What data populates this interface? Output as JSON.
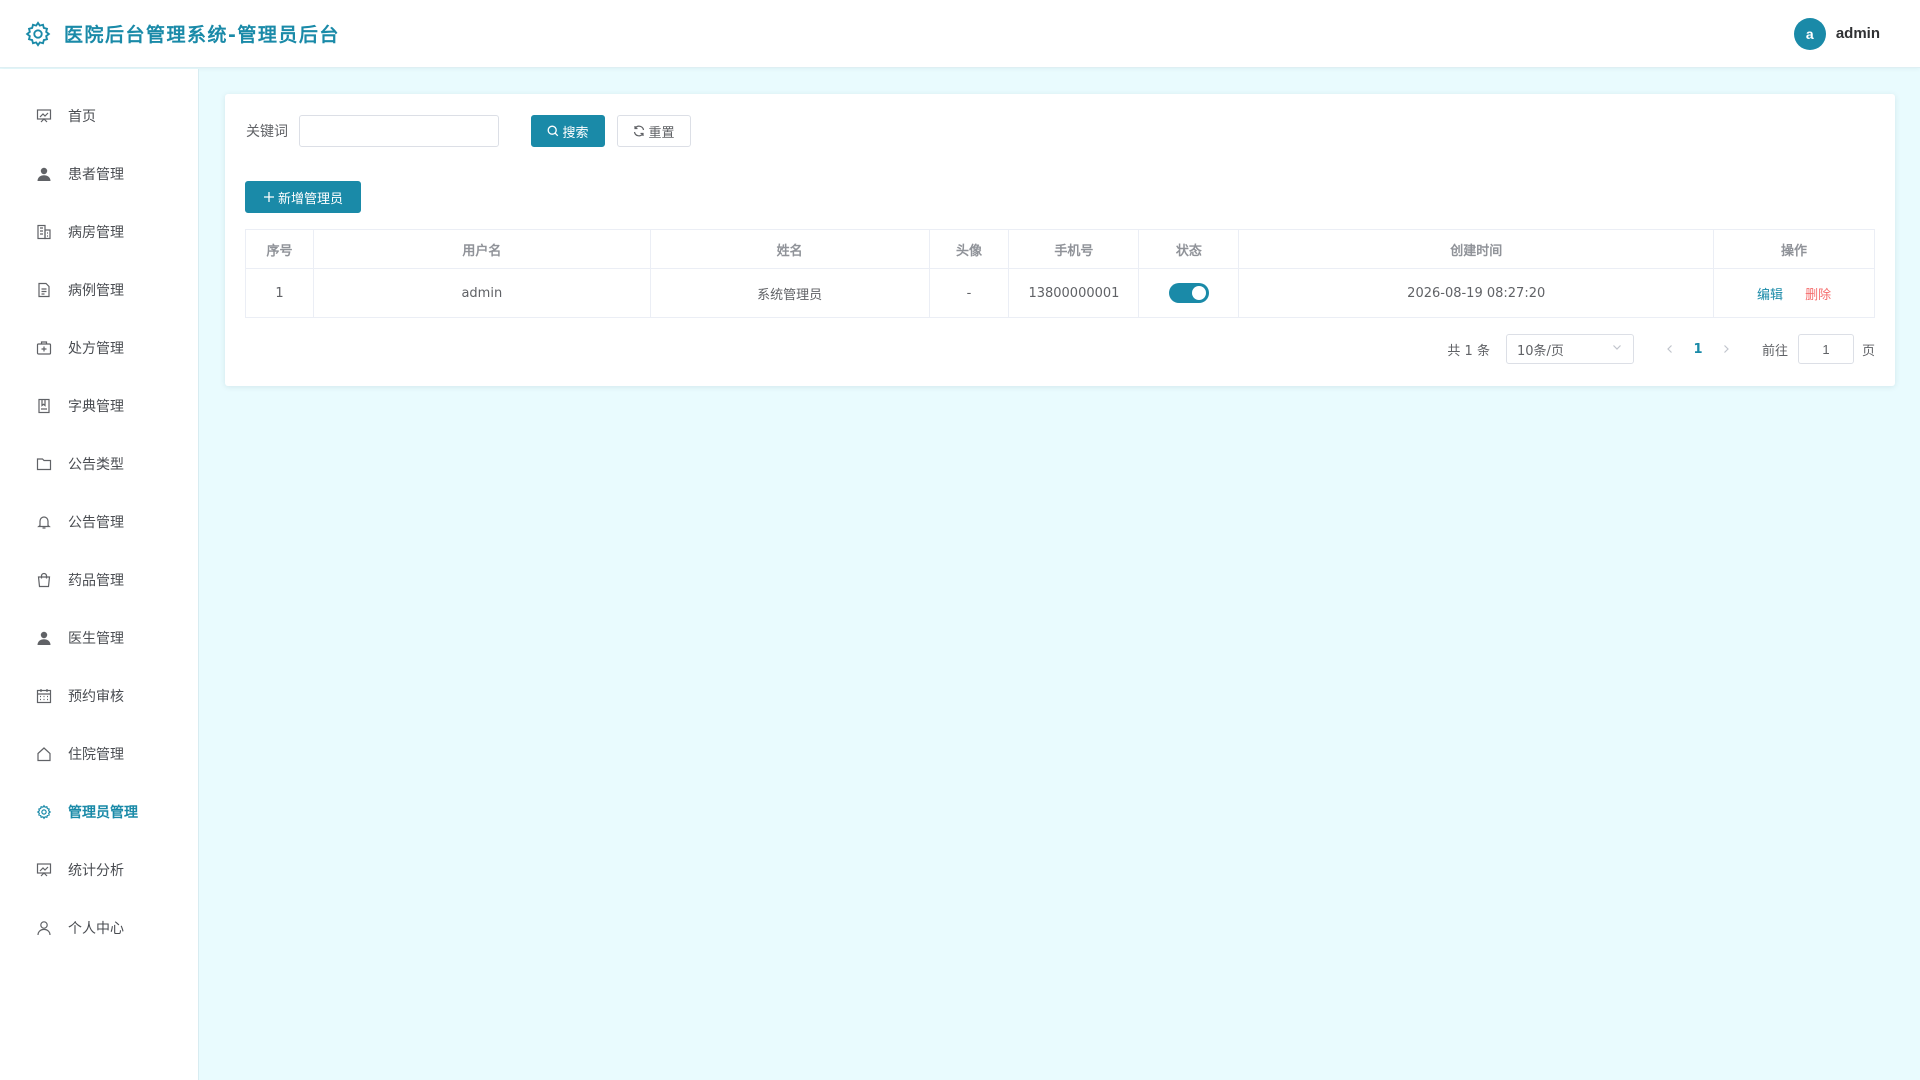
{
  "header": {
    "title": "医院后台管理系统-管理员后台",
    "avatar_letter": "a",
    "username": "admin"
  },
  "sidebar": {
    "items": [
      {
        "label": "首页",
        "icon": "chart-board-icon"
      },
      {
        "label": "患者管理",
        "icon": "user-filled-icon"
      },
      {
        "label": "病房管理",
        "icon": "building-icon"
      },
      {
        "label": "病例管理",
        "icon": "document-icon"
      },
      {
        "label": "处方管理",
        "icon": "first-aid-kit-icon"
      },
      {
        "label": "字典管理",
        "icon": "notebook-icon"
      },
      {
        "label": "公告类型",
        "icon": "folder-icon"
      },
      {
        "label": "公告管理",
        "icon": "bell-icon"
      },
      {
        "label": "药品管理",
        "icon": "shopping-bag-icon"
      },
      {
        "label": "医生管理",
        "icon": "user-filled-icon"
      },
      {
        "label": "预约审核",
        "icon": "calendar-icon"
      },
      {
        "label": "住院管理",
        "icon": "house-icon"
      },
      {
        "label": "管理员管理",
        "icon": "gear-icon",
        "active": true
      },
      {
        "label": "统计分析",
        "icon": "chart-board-icon"
      },
      {
        "label": "个人中心",
        "icon": "user-outline-icon"
      }
    ]
  },
  "search": {
    "keyword_label": "关键词",
    "keyword_value": "",
    "search_label": "搜索",
    "reset_label": "重置"
  },
  "toolbar": {
    "add_label": "新增管理员"
  },
  "table": {
    "columns": [
      "序号",
      "用户名",
      "姓名",
      "头像",
      "手机号",
      "状态",
      "创建时间",
      "操作"
    ],
    "rows": [
      {
        "index": "1",
        "username": "admin",
        "name": "系统管理员",
        "avatar": "-",
        "phone": "13800000001",
        "status_on": true,
        "created": "2026-08-19 08:27:20",
        "edit_label": "编辑",
        "delete_label": "删除"
      }
    ]
  },
  "pagination": {
    "total_text": "共 1 条",
    "page_size": "10条/页",
    "current_page": "1",
    "goto_label": "前往",
    "goto_value": "1",
    "page_suffix": "页"
  },
  "colors": {
    "accent": "#1a8aa8",
    "danger": "#f56c6c",
    "background": "#e9fbfe"
  }
}
